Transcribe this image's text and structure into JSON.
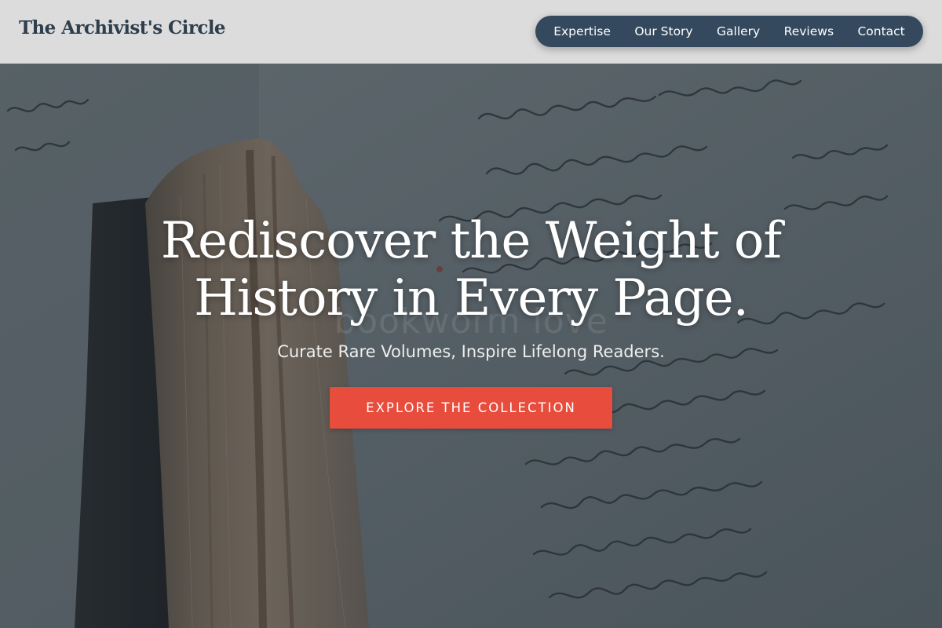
{
  "header": {
    "brand": "The Archivist's Circle",
    "nav": {
      "bg_color": "#34495e",
      "items": [
        {
          "label": "Expertise"
        },
        {
          "label": "Our Story"
        },
        {
          "label": "Gallery"
        },
        {
          "label": "Reviews"
        },
        {
          "label": "Contact"
        }
      ]
    }
  },
  "hero": {
    "background_image": "old-book-with-handwritten-manuscript",
    "title_line1": "Rediscover the Weight of",
    "title_line2": "History in Every Page.",
    "watermark": "bookworm love",
    "subtitle": "Curate Rare Volumes, Inspire Lifelong Readers.",
    "cta_label": "EXPLORE THE COLLECTION",
    "cta_color": "#e74c3c"
  }
}
